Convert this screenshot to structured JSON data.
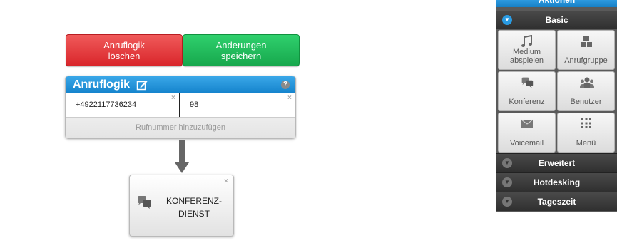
{
  "toolbar": {
    "delete_label": "Anruflogik\nlöschen",
    "save_label": "Änderungen\nspeichern"
  },
  "logic": {
    "title": "Anruflogik",
    "help": "?",
    "entry_number": "+4922117736234",
    "entry_value": "98",
    "close": "×",
    "add_label": "Rufnummer hinzuzufügen"
  },
  "conference": {
    "label": "KONFERENZ-\nDIENST",
    "close": "×"
  },
  "panel": {
    "top_label": "Aktionen",
    "sections": {
      "basic": "Basic",
      "erweitert": "Erweitert",
      "hotdesking": "Hotdesking",
      "tageszeit": "Tageszeit"
    },
    "tiles": [
      {
        "label": "Medium\nabspielen",
        "icon": "music-icon"
      },
      {
        "label": "Anrufgruppe",
        "icon": "group-icon"
      },
      {
        "label": "Konferenz",
        "icon": "conference-icon"
      },
      {
        "label": "Benutzer",
        "icon": "users-icon"
      },
      {
        "label": "Voicemail",
        "icon": "voicemail-icon"
      },
      {
        "label": "Menü",
        "icon": "menu-grid-icon"
      }
    ]
  },
  "colors": {
    "red": "#d9262b",
    "green": "#17a84d",
    "blue": "#1483cc"
  }
}
